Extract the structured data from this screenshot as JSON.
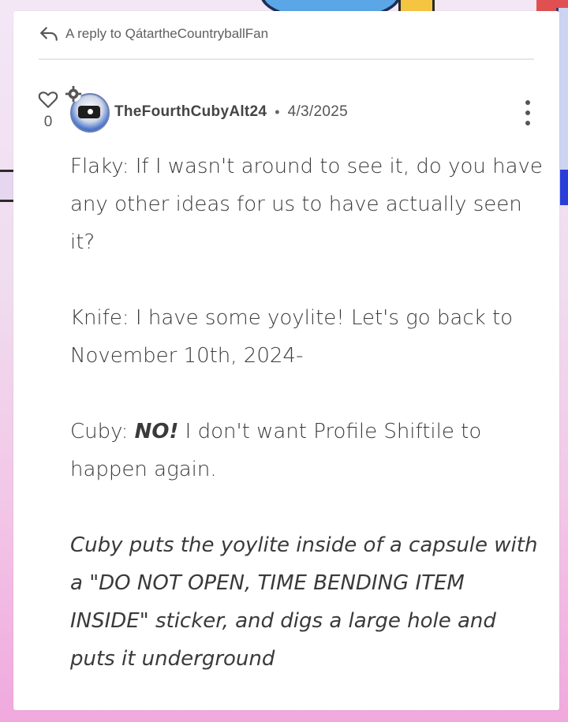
{
  "reply": {
    "label": "A reply to QátartheCountryballFan"
  },
  "votes": {
    "count": "0"
  },
  "post": {
    "author": "TheFourthCubyAlt24",
    "separator": "•",
    "date": "4/3/2025",
    "paragraphs": {
      "p1": "Flaky: If I wasn't around to see it, do you have any other ideas for us to have actually seen it?",
      "p2": "Knife: I have some yoylite! Let's go back to November 10th, 2024-",
      "p3_prefix": "Cuby: ",
      "p3_emphasis": "NO!",
      "p3_suffix": " I don't want Profile Shiftile to happen again.",
      "p4": "Cuby puts the yoylite inside of a capsule with a \"DO NOT OPEN, TIME BENDING ITEM INSIDE\" sticker, and digs a large hole and puts it underground"
    }
  },
  "icons": {
    "reply": "reply-arrow-icon",
    "like": "heart-icon",
    "badge": "settings-badge-icon",
    "menu": "more-vertical-icon"
  },
  "colors": {
    "text": "#3a3a3a",
    "muted": "#5f5f5f",
    "card": "#ffffff",
    "background_pink": "#f0a9de"
  }
}
